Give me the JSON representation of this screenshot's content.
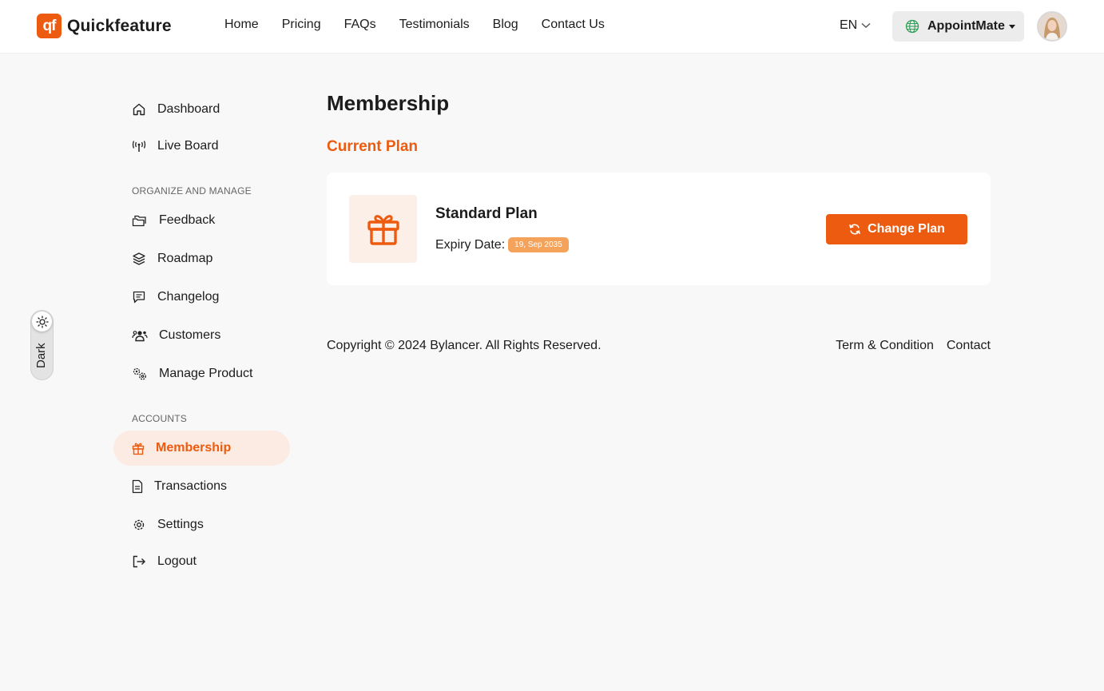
{
  "header": {
    "logo_mark": "qf",
    "logo_text": "Quickfeature",
    "nav": [
      "Home",
      "Pricing",
      "FAQs",
      "Testimonials",
      "Blog",
      "Contact Us"
    ],
    "language": "EN",
    "project": "AppointMate"
  },
  "theme_toggle": {
    "label": "Dark"
  },
  "sidebar": {
    "items_top": [
      {
        "label": "Dashboard",
        "icon": "home-icon"
      },
      {
        "label": "Live Board",
        "icon": "broadcast-icon"
      }
    ],
    "heading_organize": "ORGANIZE AND MANAGE",
    "items_organize": [
      {
        "label": "Feedback",
        "icon": "folders-icon"
      },
      {
        "label": "Roadmap",
        "icon": "layers-icon"
      },
      {
        "label": "Changelog",
        "icon": "message-icon"
      },
      {
        "label": "Customers",
        "icon": "users-icon"
      },
      {
        "label": "Manage Product",
        "icon": "gears-icon"
      }
    ],
    "heading_accounts": "ACCOUNTS",
    "items_accounts": [
      {
        "label": "Membership",
        "icon": "gift-icon",
        "active": true
      },
      {
        "label": "Transactions",
        "icon": "document-icon"
      },
      {
        "label": "Settings",
        "icon": "gear-icon"
      },
      {
        "label": "Logout",
        "icon": "logout-icon"
      }
    ]
  },
  "main": {
    "title": "Membership",
    "section_title": "Current Plan",
    "plan": {
      "name": "Standard Plan",
      "expiry_label": "Expiry Date:",
      "expiry_value": "19, Sep 2035",
      "change_button": "Change Plan"
    }
  },
  "footer": {
    "copyright": "Copyright © 2024 Bylancer. All Rights Reserved.",
    "links": [
      "Term & Condition",
      "Contact"
    ]
  },
  "colors": {
    "accent": "#ec5b0f",
    "badge": "#f5a35b",
    "active_bg": "#fcebe2",
    "page_bg": "#f8f8f8"
  }
}
